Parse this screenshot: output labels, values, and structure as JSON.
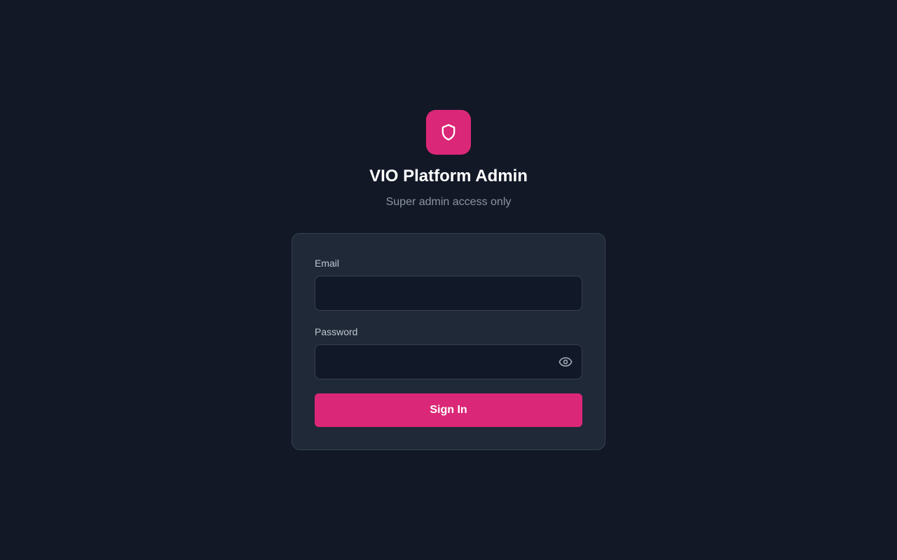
{
  "brand": {
    "icon": "shield-icon",
    "accent_color": "#db2777",
    "title": "VIO Platform Admin",
    "subtitle": "Super admin access only"
  },
  "login_form": {
    "email": {
      "label": "Email",
      "value": "",
      "placeholder": ""
    },
    "password": {
      "label": "Password",
      "value": "",
      "placeholder": "",
      "toggle_icon": "eye-icon"
    },
    "submit_label": "Sign In"
  },
  "colors": {
    "background": "#121826",
    "card_background": "#1f2937",
    "input_background": "#111827",
    "border": "#374151"
  }
}
